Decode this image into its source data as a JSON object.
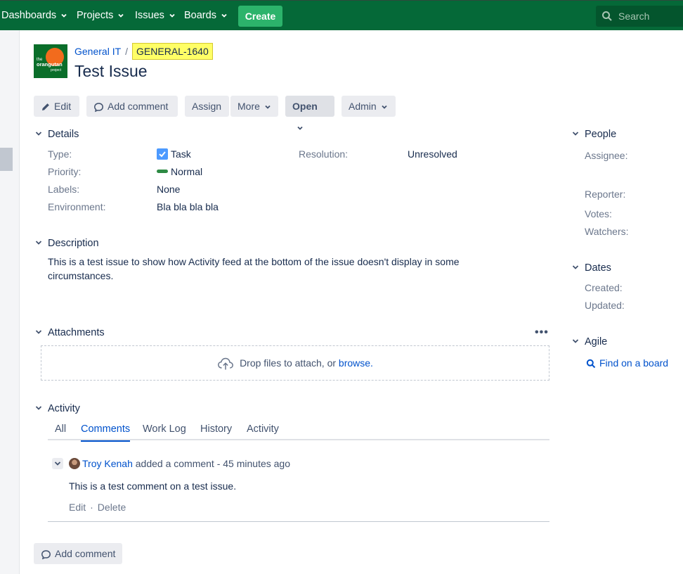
{
  "nav": {
    "items": [
      {
        "label": "Dashboards"
      },
      {
        "label": "Projects"
      },
      {
        "label": "Issues"
      },
      {
        "label": "Boards"
      }
    ],
    "create_label": "Create",
    "search_placeholder": "Search"
  },
  "header": {
    "logo_text": [
      "the",
      "orangutan",
      "project"
    ],
    "project_name": "General IT",
    "issue_key": "GENERAL-1640",
    "title": "Test Issue"
  },
  "toolbar": {
    "edit": "Edit",
    "add_comment": "Add comment",
    "assign": "Assign",
    "more": "More",
    "open": "Open",
    "admin": "Admin"
  },
  "details": {
    "heading": "Details",
    "type_label": "Type:",
    "type_value": "Task",
    "priority_label": "Priority:",
    "priority_value": "Normal",
    "labels_label": "Labels:",
    "labels_value": "None",
    "environment_label": "Environment:",
    "environment_value": "Bla bla bla bla",
    "resolution_label": "Resolution:",
    "resolution_value": "Unresolved"
  },
  "description": {
    "heading": "Description",
    "text": "This is a test issue to show how Activity feed at the bottom of the issue doesn't display in some circumstances."
  },
  "attachments": {
    "heading": "Attachments",
    "drop_text": "Drop files to attach, or ",
    "browse_link": "browse.",
    "menu": "•••"
  },
  "activity": {
    "heading": "Activity",
    "tabs": [
      "All",
      "Comments",
      "Work Log",
      "History",
      "Activity"
    ],
    "active_tab": "Comments",
    "comment": {
      "author": "Troy Kenah",
      "action": " added a comment - 45 minutes ago",
      "body": "This is a test comment on a test issue.",
      "edit": "Edit",
      "separator": "·",
      "delete": "Delete"
    },
    "add_comment": "Add comment"
  },
  "people": {
    "heading": "People",
    "assignee": "Assignee:",
    "reporter": "Reporter:",
    "votes": "Votes:",
    "watchers": "Watchers:"
  },
  "dates": {
    "heading": "Dates",
    "created": "Created:",
    "updated": "Updated:"
  },
  "agile": {
    "heading": "Agile",
    "link": "Find on a board"
  },
  "colors": {
    "nav_bg": "#056938",
    "create_bg": "#2cb36b",
    "link": "#0052cc",
    "key_highlight": "#ffff66"
  }
}
